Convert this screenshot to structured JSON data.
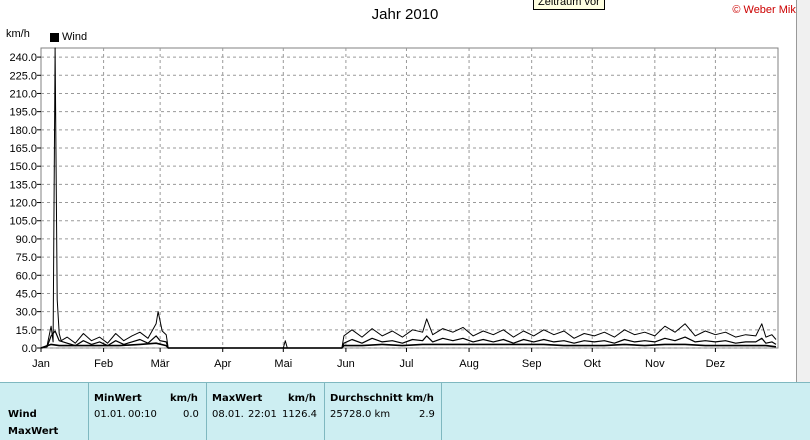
{
  "header": {
    "title": "Jahr 2010",
    "tooltip": "Zeitraum vor",
    "copyright": "© Weber Mike"
  },
  "chart_data": {
    "type": "line",
    "title": "Jahr 2010",
    "ylabel": "km/h",
    "legend": {
      "label": "Wind",
      "placement": "top-left"
    },
    "grid": true,
    "ylim": [
      0,
      247.5
    ],
    "y_ticks": [
      "0.0",
      "15.0",
      "30.0",
      "45.0",
      "60.0",
      "75.0",
      "90.0",
      "105.0",
      "120.0",
      "135.0",
      "150.0",
      "165.0",
      "180.0",
      "195.0",
      "210.0",
      "225.0",
      "240.0"
    ],
    "x_ticks": [
      "Jan",
      "Feb",
      "Mär",
      "Apr",
      "Mai",
      "Jun",
      "Jul",
      "Aug",
      "Sep",
      "Okt",
      "Nov",
      "Dez"
    ],
    "x_unit": "day of year",
    "series": [
      {
        "name": "Wind",
        "points": [
          [
            1,
            0
          ],
          [
            4,
            2
          ],
          [
            6,
            18
          ],
          [
            7,
            5
          ],
          [
            8,
            248
          ],
          [
            9,
            40
          ],
          [
            10,
            12
          ],
          [
            11,
            6
          ],
          [
            14,
            9
          ],
          [
            18,
            4
          ],
          [
            22,
            12
          ],
          [
            26,
            6
          ],
          [
            30,
            9
          ],
          [
            34,
            4
          ],
          [
            38,
            12
          ],
          [
            42,
            6
          ],
          [
            46,
            10
          ],
          [
            50,
            13
          ],
          [
            54,
            8
          ],
          [
            58,
            20
          ],
          [
            59,
            30
          ],
          [
            61,
            14
          ],
          [
            63,
            11
          ],
          [
            64,
            0
          ],
          [
            120,
            0
          ],
          [
            121,
            0
          ],
          [
            122,
            6
          ],
          [
            123,
            0
          ],
          [
            150,
            0
          ],
          [
            151,
            10
          ],
          [
            155,
            15
          ],
          [
            160,
            9
          ],
          [
            165,
            16
          ],
          [
            170,
            10
          ],
          [
            175,
            14
          ],
          [
            180,
            9
          ],
          [
            185,
            15
          ],
          [
            190,
            13
          ],
          [
            192,
            24
          ],
          [
            195,
            11
          ],
          [
            200,
            16
          ],
          [
            205,
            13
          ],
          [
            210,
            17
          ],
          [
            215,
            10
          ],
          [
            220,
            14
          ],
          [
            225,
            11
          ],
          [
            230,
            15
          ],
          [
            235,
            9
          ],
          [
            240,
            14
          ],
          [
            245,
            10
          ],
          [
            250,
            15
          ],
          [
            255,
            11
          ],
          [
            260,
            14
          ],
          [
            265,
            8
          ],
          [
            270,
            12
          ],
          [
            275,
            10
          ],
          [
            280,
            13
          ],
          [
            285,
            9
          ],
          [
            290,
            15
          ],
          [
            295,
            11
          ],
          [
            300,
            13
          ],
          [
            305,
            10
          ],
          [
            310,
            18
          ],
          [
            315,
            13
          ],
          [
            320,
            20
          ],
          [
            325,
            10
          ],
          [
            330,
            14
          ],
          [
            335,
            11
          ],
          [
            340,
            13
          ],
          [
            345,
            9
          ],
          [
            350,
            11
          ],
          [
            355,
            10
          ],
          [
            358,
            20
          ],
          [
            360,
            9
          ],
          [
            363,
            11
          ],
          [
            365,
            7
          ]
        ]
      },
      {
        "name": "",
        "points": [
          [
            1,
            0
          ],
          [
            4,
            1
          ],
          [
            6,
            10
          ],
          [
            8,
            14
          ],
          [
            10,
            6
          ],
          [
            14,
            4
          ],
          [
            18,
            2
          ],
          [
            22,
            6
          ],
          [
            26,
            3
          ],
          [
            30,
            5
          ],
          [
            34,
            2
          ],
          [
            38,
            6
          ],
          [
            42,
            3
          ],
          [
            46,
            5
          ],
          [
            50,
            7
          ],
          [
            54,
            4
          ],
          [
            58,
            10
          ],
          [
            60,
            6
          ],
          [
            63,
            5
          ],
          [
            64,
            0
          ],
          [
            150,
            0
          ],
          [
            151,
            4
          ],
          [
            155,
            7
          ],
          [
            160,
            4
          ],
          [
            165,
            8
          ],
          [
            170,
            5
          ],
          [
            175,
            6
          ],
          [
            180,
            4
          ],
          [
            185,
            7
          ],
          [
            190,
            6
          ],
          [
            192,
            10
          ],
          [
            195,
            5
          ],
          [
            200,
            8
          ],
          [
            205,
            6
          ],
          [
            210,
            8
          ],
          [
            215,
            5
          ],
          [
            220,
            7
          ],
          [
            225,
            5
          ],
          [
            230,
            7
          ],
          [
            235,
            4
          ],
          [
            240,
            7
          ],
          [
            245,
            5
          ],
          [
            250,
            7
          ],
          [
            255,
            5
          ],
          [
            260,
            6
          ],
          [
            265,
            4
          ],
          [
            270,
            6
          ],
          [
            275,
            5
          ],
          [
            280,
            6
          ],
          [
            285,
            4
          ],
          [
            290,
            7
          ],
          [
            295,
            5
          ],
          [
            300,
            6
          ],
          [
            305,
            5
          ],
          [
            310,
            8
          ],
          [
            315,
            6
          ],
          [
            320,
            9
          ],
          [
            325,
            5
          ],
          [
            330,
            6
          ],
          [
            335,
            5
          ],
          [
            340,
            6
          ],
          [
            345,
            4
          ],
          [
            350,
            5
          ],
          [
            355,
            5
          ],
          [
            358,
            8
          ],
          [
            360,
            4
          ],
          [
            363,
            5
          ],
          [
            365,
            3
          ]
        ]
      },
      {
        "name": "",
        "points": [
          [
            1,
            0
          ],
          [
            6,
            3
          ],
          [
            10,
            2
          ],
          [
            20,
            2
          ],
          [
            30,
            2
          ],
          [
            40,
            2
          ],
          [
            50,
            3
          ],
          [
            58,
            4
          ],
          [
            63,
            2
          ],
          [
            64,
            0
          ],
          [
            150,
            0
          ],
          [
            151,
            2
          ],
          [
            160,
            2
          ],
          [
            170,
            3
          ],
          [
            180,
            2
          ],
          [
            190,
            3
          ],
          [
            200,
            3
          ],
          [
            210,
            3
          ],
          [
            220,
            3
          ],
          [
            230,
            3
          ],
          [
            240,
            3
          ],
          [
            250,
            3
          ],
          [
            260,
            2
          ],
          [
            270,
            2
          ],
          [
            280,
            2
          ],
          [
            290,
            3
          ],
          [
            300,
            2
          ],
          [
            310,
            3
          ],
          [
            320,
            3
          ],
          [
            330,
            2
          ],
          [
            340,
            2
          ],
          [
            350,
            2
          ],
          [
            360,
            2
          ],
          [
            365,
            1
          ]
        ]
      }
    ]
  },
  "summary_table": {
    "row_labels": [
      "Wind",
      "MaxWert"
    ],
    "minwert": {
      "header": "MinWert",
      "unit": "km/h",
      "date": "01.01.",
      "time": "00:10",
      "value": "0.0"
    },
    "maxwert": {
      "header": "MaxWert",
      "unit": "km/h",
      "date": "08.01.",
      "time": "22:01",
      "value": "1126.4"
    },
    "durchschnitt": {
      "header": "Durchschnitt km/h",
      "distance": "25728.0 km",
      "value": "2.9"
    }
  }
}
